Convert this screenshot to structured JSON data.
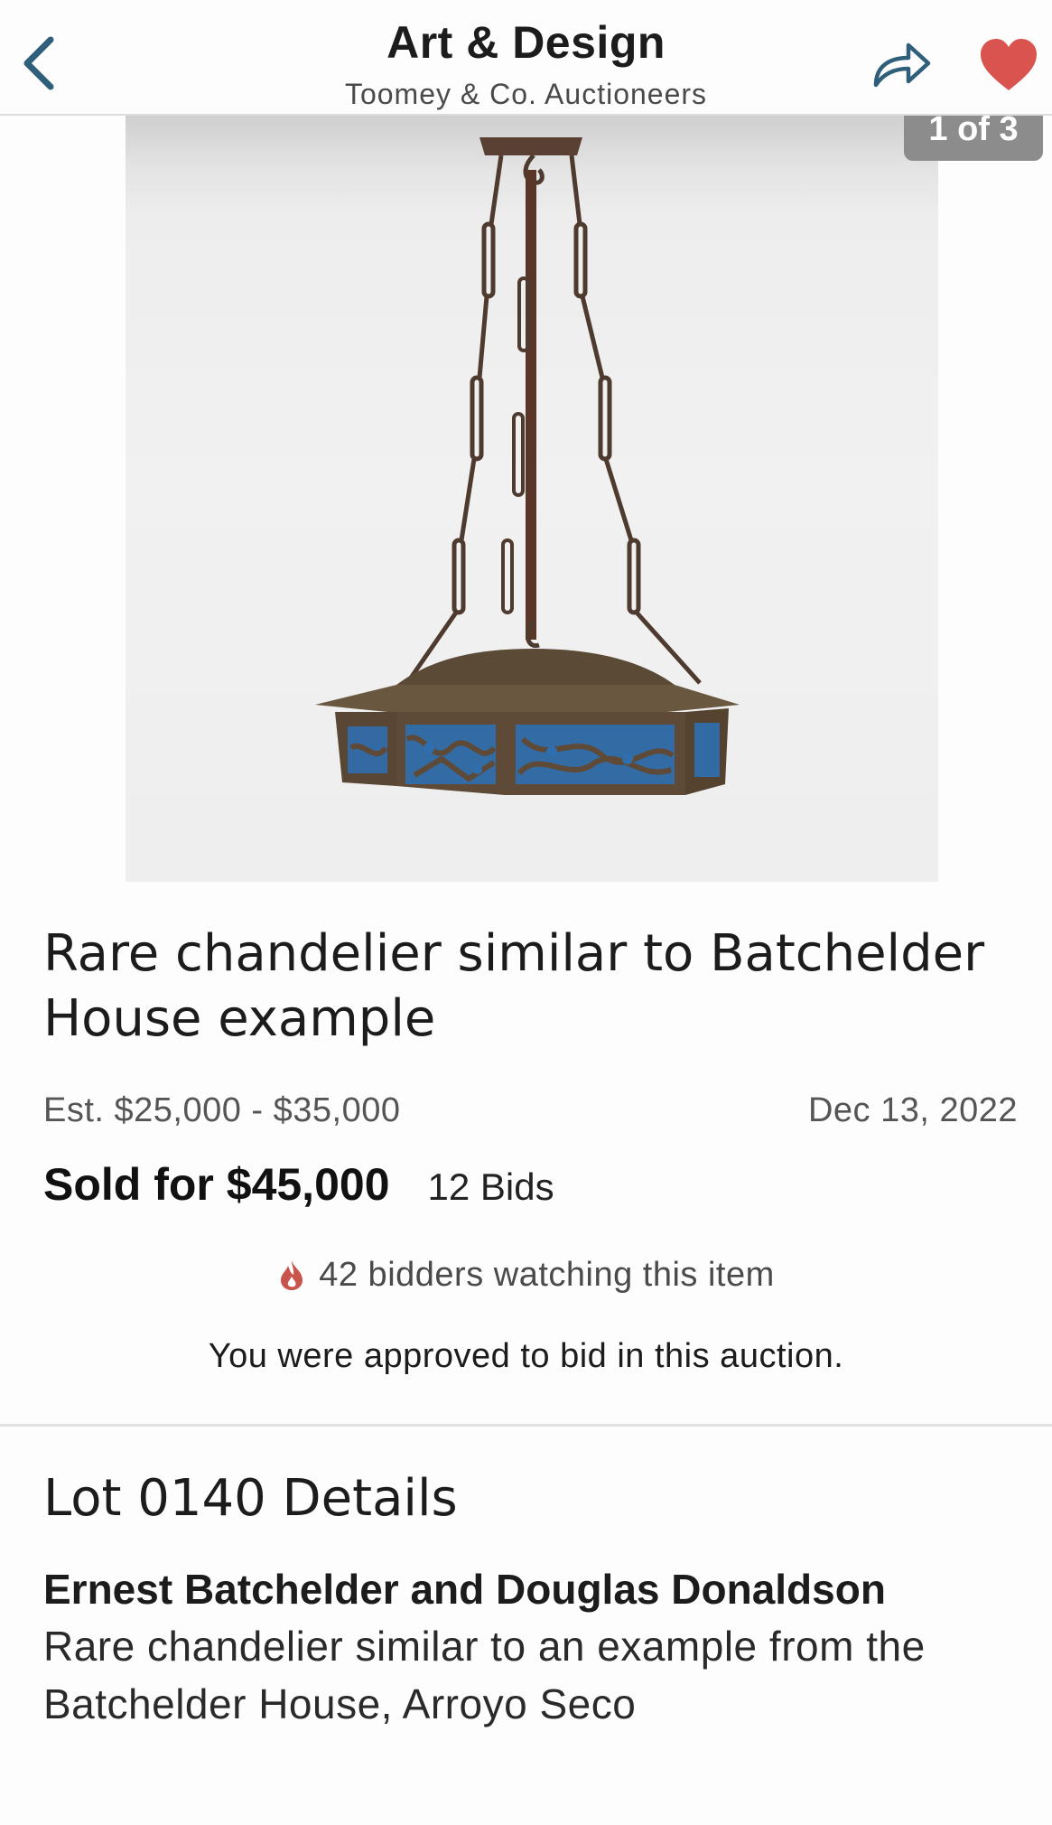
{
  "header": {
    "title": "Art & Design",
    "subtitle": "Toomey & Co. Auctioneers",
    "back_icon": "chevron-left-icon",
    "share_icon": "share-arrow-icon",
    "favorite_icon": "heart-icon"
  },
  "gallery": {
    "counter": "1 of 3"
  },
  "lot": {
    "title": "Rare chandelier similar to Batchelder House example",
    "estimate": "Est. $25,000 - $35,000",
    "date": "Dec 13, 2022",
    "sold_for": "Sold for $45,000",
    "bids": "12 Bids",
    "watchers": "42 bidders watching this item",
    "approved": "You were approved to bid in this auction."
  },
  "details": {
    "heading": "Lot 0140 Details",
    "artist": "Ernest Batchelder and Douglas Donaldson",
    "description": "Rare chandelier similar to an example from the Batchelder House, Arroyo Seco"
  },
  "colors": {
    "accent_blue": "#2f5f7a",
    "heart_red": "#d9534f",
    "flame_red": "#c9544b"
  }
}
